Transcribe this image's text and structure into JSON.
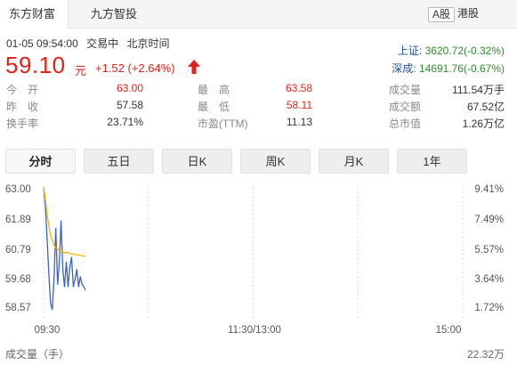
{
  "source_tabs": [
    {
      "label": "东方财富",
      "active": true
    },
    {
      "label": "九方智投",
      "active": false
    }
  ],
  "market_tabs": [
    {
      "label": "A股",
      "active": true
    },
    {
      "label": "港股",
      "active": false
    }
  ],
  "quote": {
    "datetime": "01-05 09:54:00",
    "status": "交易中",
    "timezone": "北京时间",
    "price": "59.10",
    "unit": "元",
    "change": "+1.52 (+2.64%)",
    "up_color": "#e2231a",
    "down_color": "#2e8b2e"
  },
  "indices": [
    {
      "name": "上证:",
      "value": "3620.72(-0.32%)"
    },
    {
      "name": "深成:",
      "value": "14691.76(-0.67%)"
    }
  ],
  "stats": [
    [
      {
        "label": "今　开",
        "value": "63.00",
        "tone": "red"
      },
      {
        "label": "最　高",
        "value": "63.58",
        "tone": "red"
      },
      {
        "label": "成交量",
        "value": "111.54万手",
        "tone": "blk"
      }
    ],
    [
      {
        "label": "昨　收",
        "value": "57.58",
        "tone": "blk"
      },
      {
        "label": "最　低",
        "value": "58.11",
        "tone": "red"
      },
      {
        "label": "成交额",
        "value": "67.52亿",
        "tone": "blk"
      }
    ],
    [
      {
        "label": "换手率",
        "value": "23.71%",
        "tone": "blk"
      },
      {
        "label": "市盈(TTM)",
        "value": "11.13",
        "tone": "blk"
      },
      {
        "label": "总市值",
        "value": "1.26万亿",
        "tone": "blk"
      }
    ]
  ],
  "period_tabs": [
    {
      "label": "分时",
      "active": true
    },
    {
      "label": "五日",
      "active": false
    },
    {
      "label": "日K",
      "active": false
    },
    {
      "label": "周K",
      "active": false
    },
    {
      "label": "月K",
      "active": false
    },
    {
      "label": "1年",
      "active": false
    }
  ],
  "chart_data": {
    "type": "line",
    "title": "",
    "xlabel": "",
    "ylabel": "",
    "y_ticks": [
      "63.00",
      "61.89",
      "60.79",
      "59.68",
      "58.57"
    ],
    "pct_ticks": [
      "9.41%",
      "7.49%",
      "5.57%",
      "3.64%",
      "1.72%"
    ],
    "x_ticks": [
      "09:30",
      "11:30/13:00",
      "15:00"
    ],
    "ylim": [
      57.58,
      63.0
    ],
    "minutes_total": 240,
    "grid": "vertical-dashed",
    "series": [
      {
        "color": "#3a62c8",
        "minutes": [
          0,
          1,
          2,
          3,
          4,
          5,
          6,
          7,
          8,
          9,
          10,
          11,
          12,
          13,
          14,
          15,
          16,
          17,
          18,
          19,
          20,
          21,
          22,
          23,
          24
        ],
        "values": [
          63.0,
          62.2,
          60.9,
          59.4,
          58.2,
          57.95,
          59.3,
          61.3,
          59.0,
          59.9,
          61.6,
          59.6,
          58.9,
          59.9,
          58.9,
          59.7,
          60.1,
          58.9,
          59.2,
          59.6,
          58.9,
          59.3,
          59.0,
          58.9,
          58.75
        ]
      },
      {
        "color": "#f2b600",
        "minutes": [
          0,
          1,
          2,
          3,
          4,
          5,
          6,
          7,
          8,
          9,
          10,
          12,
          14,
          16,
          18,
          20,
          22,
          24
        ],
        "values": [
          63.0,
          62.5,
          61.9,
          61.4,
          61.0,
          60.8,
          60.6,
          60.5,
          60.45,
          60.4,
          60.35,
          60.3,
          60.3,
          60.25,
          60.22,
          60.2,
          60.17,
          60.14
        ]
      }
    ]
  },
  "volume": {
    "label": "成交量（手）",
    "max": "22.32万"
  }
}
